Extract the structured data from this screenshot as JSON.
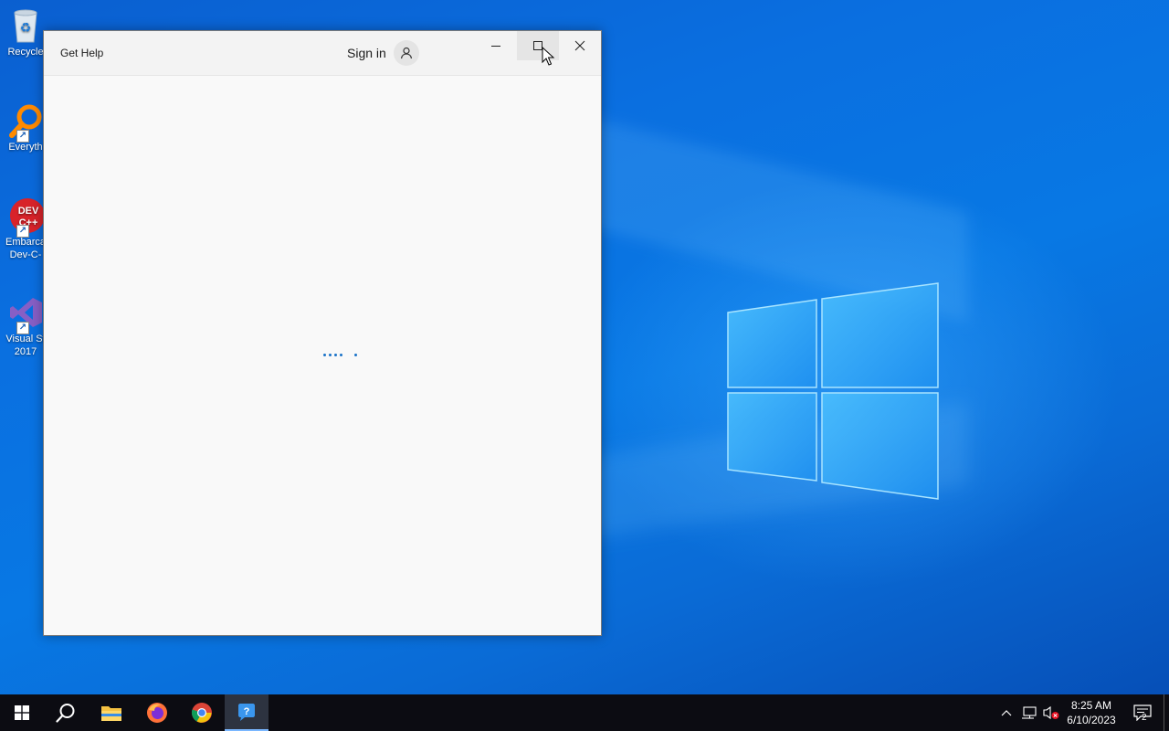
{
  "desktop": {
    "icons": [
      {
        "label": "Recycle",
        "icon": "recycle-bin-icon"
      },
      {
        "label": "Everyth",
        "icon": "everything-search-icon"
      },
      {
        "label_line1": "Embarca",
        "label_line2": "Dev-C-",
        "icon": "devcpp-icon"
      },
      {
        "label_line1": "Visual St",
        "label_line2": "2017",
        "icon": "visual-studio-icon"
      }
    ]
  },
  "window": {
    "title": "Get Help",
    "signin_label": "Sign in",
    "icons": {
      "avatar": "person-icon",
      "minimize": "minimize-icon",
      "maximize": "maximize-icon",
      "close": "close-icon"
    },
    "loading_indicator": "loading-dots"
  },
  "taskbar": {
    "apps": [
      "start",
      "search",
      "file-explorer",
      "firefox",
      "chrome",
      "get-help"
    ],
    "active_app": "get-help",
    "clock": {
      "time": "8:25 AM",
      "date": "6/10/2023"
    },
    "notification_count": "2"
  },
  "colors": {
    "accent": "#0a6fe0",
    "taskbar": "#0c0c12",
    "window_bg": "#f9f9f9",
    "loader": "#1a73c8"
  }
}
